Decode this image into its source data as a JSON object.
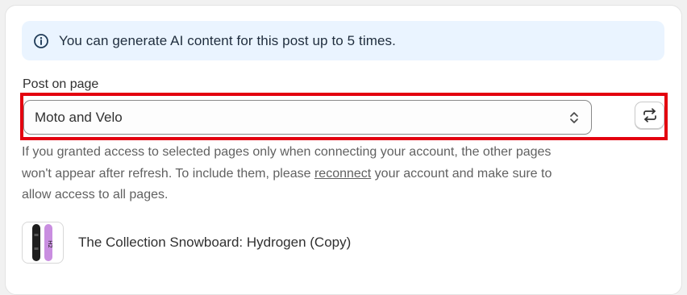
{
  "banner": {
    "icon": "info-icon",
    "text": "You can generate AI content for this post up to 5 times."
  },
  "page_select": {
    "label": "Post on page",
    "value": "Moto and Velo",
    "chevron_icon": "chevron-up-down-icon",
    "refresh_icon": "refresh-arrows-icon"
  },
  "help": {
    "before_link": "If you granted access to selected pages only when connecting your account, the other pages won't appear after refresh. To include them, please ",
    "link": "reconnect",
    "after_link": " your account and make sure to allow access to all pages."
  },
  "product": {
    "title": "The Collection Snowboard: Hydrogen (Copy)",
    "board_colors": [
      "#1e1e1e",
      "#c98ee0"
    ]
  },
  "colors": {
    "banner_bg": "#eaf4ff",
    "highlight": "#e3000f"
  }
}
